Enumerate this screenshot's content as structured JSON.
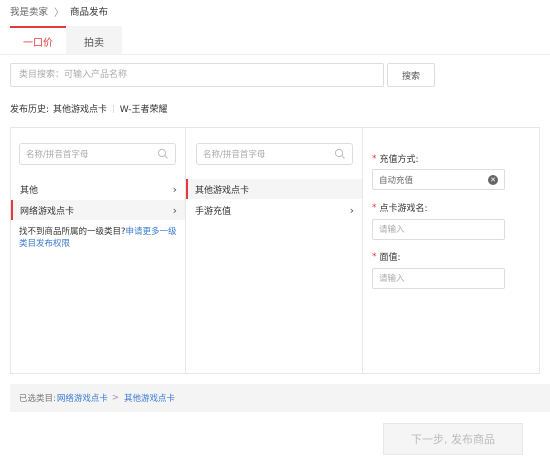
{
  "breadcrumb": {
    "parent": "我是卖家",
    "separator": "〉",
    "current": "商品发布"
  },
  "tabs": [
    {
      "label": "一口价",
      "active": true
    },
    {
      "label": "拍卖",
      "active": false
    }
  ],
  "search": {
    "placeholder": "类目搜索：可输入产品名称",
    "button_label": "搜索"
  },
  "history": {
    "label": "发布历史:",
    "items": [
      "其他游戏点卡",
      "W-王者荣耀"
    ],
    "separator": "|"
  },
  "column1": {
    "search_placeholder": "名称/拼音首字母",
    "items": [
      {
        "label": "其他",
        "selected": false,
        "has_children": true
      },
      {
        "label": "网络游戏点卡",
        "selected": true,
        "has_children": true
      }
    ],
    "not_found_text": "找不到商品所属的一级类目?",
    "not_found_link": "申请更多一级类目发布权限"
  },
  "column2": {
    "search_placeholder": "名称/拼音首字母",
    "items": [
      {
        "label": "其他游戏点卡",
        "selected": true,
        "has_children": false
      },
      {
        "label": "手游充值",
        "selected": false,
        "has_children": true
      }
    ]
  },
  "form": {
    "recharge_method": {
      "label": "充值方式:",
      "required": true,
      "value": "自动充值"
    },
    "game_name": {
      "label": "点卡游戏名:",
      "required": true,
      "placeholder": "请输入"
    },
    "face_value": {
      "label": "面值:",
      "required": true,
      "placeholder": "请输入"
    }
  },
  "selected_category": {
    "label": "已选类目:",
    "path": [
      "网络游戏点卡",
      "其他游戏点卡"
    ],
    "arrow": ">"
  },
  "next_button": {
    "label": "下一步, 发布商品",
    "enabled": false
  },
  "colors": {
    "accent": "#e4393c",
    "link": "#3a7bd5",
    "border": "#e6e6e6",
    "disabled_bg": "#f5f5f5"
  }
}
